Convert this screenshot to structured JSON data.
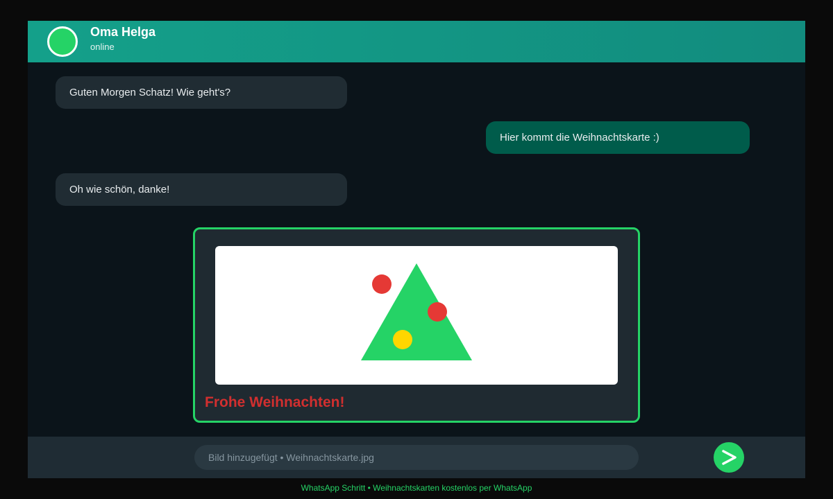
{
  "header": {
    "contact_name": "Oma Helga",
    "status": "online"
  },
  "messages": [
    {
      "direction": "incoming",
      "text": "Guten Morgen Schatz! Wie geht's?"
    },
    {
      "direction": "outgoing",
      "text": "Hier kommt die Weihnachtskarte :)"
    },
    {
      "direction": "incoming",
      "text": "Oh wie schön, danke!"
    }
  ],
  "card": {
    "greeting": "Frohe Weihnachten!",
    "image_icon": "christmas-tree-icon"
  },
  "composer": {
    "input_text": "Bild hinzugefügt • Weihnachtskarte.jpg",
    "send_icon": "send-icon"
  },
  "caption": "WhatsApp Schritt • Weihnachtskarten kostenlos per WhatsApp",
  "colors": {
    "accent": "#25d366",
    "header": "#128c7e",
    "background": "#0b141a",
    "incoming_bubble": "#202c33",
    "outgoing_bubble": "#005c4b",
    "greeting": "#d12f2f"
  }
}
